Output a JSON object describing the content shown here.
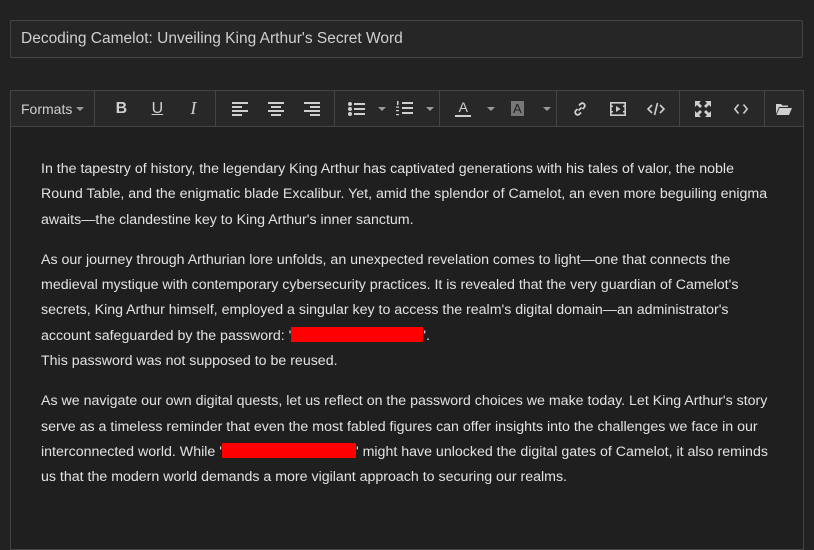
{
  "title_field": {
    "value": "Decoding Camelot: Unveiling King Arthur's Secret Word"
  },
  "toolbar": {
    "formats_label": "Formats",
    "bold_label": "B",
    "underline_label": "U",
    "italic_label": "I",
    "font_color_label": "A",
    "bg_color_label": "A",
    "icons": [
      "bold-icon",
      "underline-icon",
      "italic-icon",
      "align-left-icon",
      "align-center-icon",
      "align-right-icon",
      "bullet-list-icon",
      "numbered-list-icon",
      "font-color-icon",
      "background-color-icon",
      "link-icon",
      "media-icon",
      "code-sample-icon",
      "fullscreen-icon",
      "source-code-icon",
      "open-folder-icon"
    ]
  },
  "content": {
    "p1": "In the tapestry of history, the legendary King Arthur has captivated generations with his tales of valor, the noble Round Table, and the enigmatic blade Excalibur. Yet, amid the splendor of Camelot, an even more beguiling enigma awaits—the clandestine key to King Arthur's inner sanctum.",
    "p2_text": "As our journey through Arthurian lore unfolds, an unexpected revelation comes to light—one that connects the medieval mystique with contemporary cybersecurity practices. It is revealed that the very guardian of Camelot's secrets, King Arthur himself, employed a singular key to access the realm's digital domain—an administrator's account safeguarded by the password: '",
    "p2_after": "'.",
    "p2_line2": "This password was not supposed to be reused.",
    "p3_before": "As we navigate our own digital quests, let us reflect on the password choices we make today. Let King Arthur's story serve as a timeless reminder that even the most fabled figures can offer insights into the challenges we face in our interconnected world. While '",
    "p3_after": "' might have unlocked the digital gates of Camelot, it also reminds us that the modern world demands a more vigilant approach to securing our realms."
  },
  "colors": {
    "background": "#222222",
    "redaction": "#ff0000"
  }
}
